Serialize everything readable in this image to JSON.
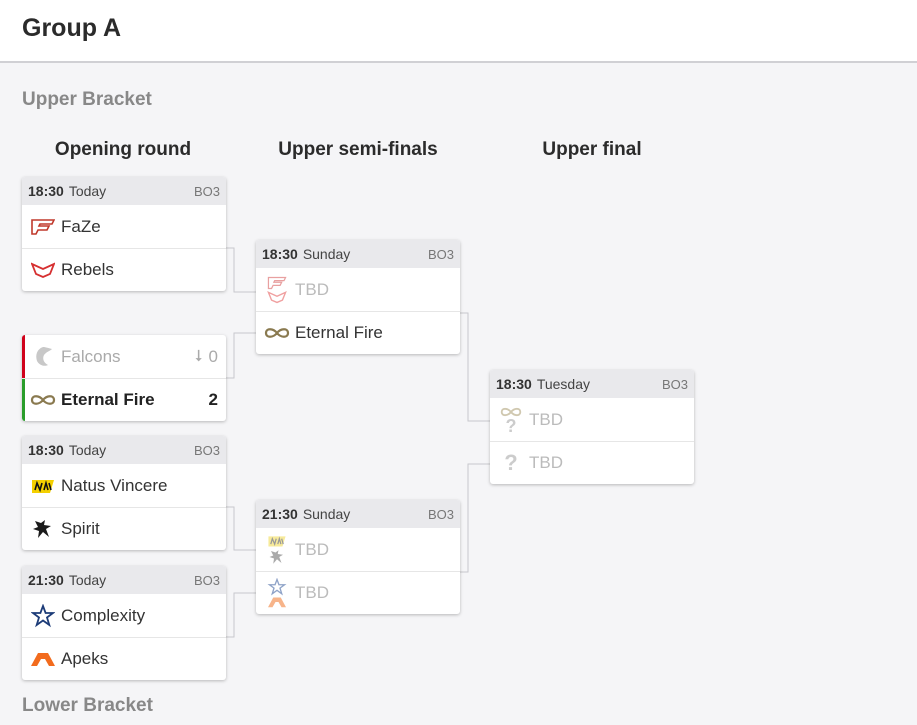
{
  "header": {
    "title": "Group A"
  },
  "sections": {
    "upper": "Upper Bracket",
    "lower": "Lower Bracket"
  },
  "rounds": {
    "opening": "Opening round",
    "semis": "Upper semi-finals",
    "final": "Upper final"
  },
  "matches": {
    "m1": {
      "time": "18:30",
      "day": "Today",
      "format": "BO3",
      "team1": "FaZe",
      "team2": "Rebels"
    },
    "m2": {
      "team1": "Falcons",
      "score1": "0",
      "team2": "Eternal Fire",
      "score2": "2"
    },
    "m3": {
      "time": "18:30",
      "day": "Today",
      "format": "BO3",
      "team1": "Natus Vincere",
      "team2": "Spirit"
    },
    "m4": {
      "time": "21:30",
      "day": "Today",
      "format": "BO3",
      "team1": "Complexity",
      "team2": "Apeks"
    },
    "s1": {
      "time": "18:30",
      "day": "Sunday",
      "format": "BO3",
      "team1": "TBD",
      "team2": "Eternal Fire"
    },
    "s2": {
      "time": "21:30",
      "day": "Sunday",
      "format": "BO3",
      "team1": "TBD",
      "team2": "TBD"
    },
    "f1": {
      "time": "18:30",
      "day": "Tuesday",
      "format": "BO3",
      "team1": "TBD",
      "team2": "TBD"
    }
  },
  "colors": {
    "loser_bar": "#d0021b",
    "winner_bar": "#2a9d2a",
    "connector": "#c8c8cc"
  }
}
